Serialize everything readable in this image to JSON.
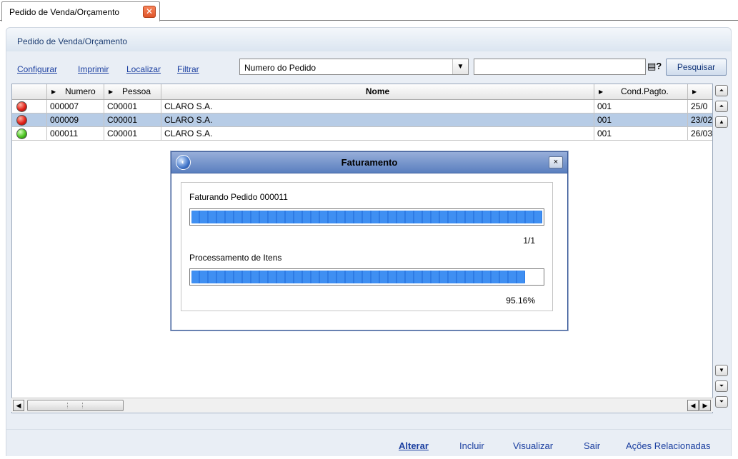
{
  "tab": {
    "label": "Pedido de Venda/Orçamento",
    "close_glyph": "✕"
  },
  "panel": {
    "title": "Pedido de Venda/Orçamento"
  },
  "toolbar": {
    "links": [
      "Configurar",
      "Imprimir",
      "Localizar",
      "Filtrar"
    ],
    "select_value": "Numero do Pedido",
    "search_value": "",
    "search_icon_glyph": "▤?",
    "search_button": "Pesquisar"
  },
  "grid": {
    "columns": [
      "",
      "Numero",
      "Pessoa",
      "Nome",
      "Cond.Pagto.",
      ""
    ],
    "rows": [
      {
        "status": "red",
        "numero": "000007",
        "pessoa": "C00001",
        "nome": "CLARO S.A.",
        "cond": "001",
        "data": "25/0",
        "selected": false
      },
      {
        "status": "red",
        "numero": "000009",
        "pessoa": "C00001",
        "nome": "CLARO S.A.",
        "cond": "001",
        "data": "23/02",
        "selected": true
      },
      {
        "status": "green",
        "numero": "000011",
        "pessoa": "C00001",
        "nome": "CLARO S.A.",
        "cond": "001",
        "data": "26/03",
        "selected": false
      }
    ]
  },
  "actions": {
    "alterar": "Alterar",
    "incluir": "Incluir",
    "visualizar": "Visualizar",
    "sair": "Sair",
    "acoes": "Ações Relacionadas"
  },
  "modal": {
    "title": "Faturamento",
    "close_glyph": "×",
    "label1": "Faturando Pedido 000011",
    "progress1": 1.0,
    "count": "1/1",
    "label2": "Processamento de Itens",
    "progress2": 0.9516,
    "percent": "95.16%"
  },
  "colors": {
    "accent": "#1a3ea0",
    "title_bar": "#5a7fbf",
    "progress": "#3f8ff2",
    "selected_row": "#b7cce6"
  },
  "icons": [
    "close-icon",
    "status-red-icon",
    "status-green-icon",
    "search-options-icon",
    "scroll-top-icon",
    "scroll-page-up-icon",
    "scroll-up-icon",
    "scroll-down-icon",
    "scroll-page-down-icon",
    "scroll-bottom-icon",
    "app-logo-icon"
  ]
}
